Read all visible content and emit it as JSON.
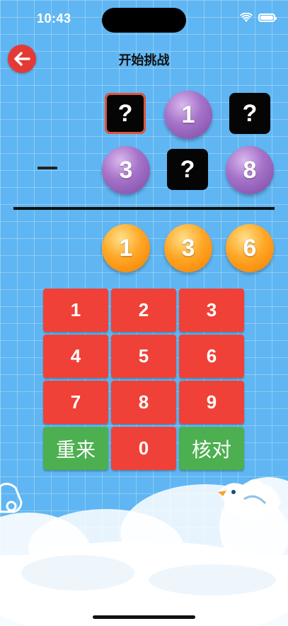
{
  "status_bar": {
    "time": "10:43"
  },
  "header": {
    "title": "开始挑战"
  },
  "puzzle": {
    "top_row": [
      {
        "kind": "unknown",
        "text": "?",
        "selected": true
      },
      {
        "kind": "ball",
        "color": "purple",
        "text": "1"
      },
      {
        "kind": "unknown",
        "text": "?"
      }
    ],
    "operator": "−",
    "bottom_row": [
      {
        "kind": "ball",
        "color": "purple",
        "text": "3"
      },
      {
        "kind": "unknown",
        "text": "?"
      },
      {
        "kind": "ball",
        "color": "purple",
        "text": "8"
      }
    ],
    "result_row": [
      {
        "kind": "ball",
        "color": "orange",
        "text": "1"
      },
      {
        "kind": "ball",
        "color": "orange",
        "text": "3"
      },
      {
        "kind": "ball",
        "color": "orange",
        "text": "6"
      }
    ]
  },
  "keypad": {
    "keys": [
      "1",
      "2",
      "3",
      "4",
      "5",
      "6",
      "7",
      "8",
      "9"
    ],
    "reset_label": "重来",
    "zero_label": "0",
    "check_label": "核对"
  },
  "colors": {
    "background": "#5fb6f2",
    "key_red": "#ef4138",
    "key_green": "#4caf50",
    "ball_purple": "#9b6bc2",
    "ball_orange": "#ffa726"
  }
}
